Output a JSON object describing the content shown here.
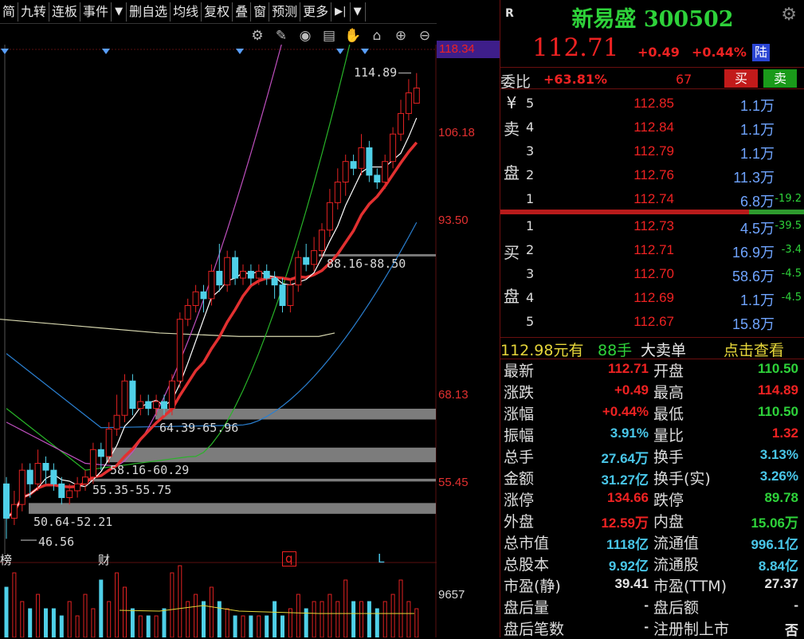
{
  "toolbar": {
    "items": [
      "简",
      "九转",
      "连板",
      "事件",
      "▼",
      "删自选",
      "均线",
      "复权",
      "叠",
      "窗",
      "预测",
      "更多",
      "▶|",
      "▼"
    ]
  },
  "chart_tools": [
    "settings-icon",
    "pen-icon",
    "eye-icon",
    "box-icon",
    "hand-icon",
    "lock-icon",
    "zoom-in-icon",
    "zoom-out-icon"
  ],
  "price_axis": {
    "top_highlight": "118.34",
    "labels": [
      "106.18",
      "93.50",
      "68.13",
      "55.45"
    ]
  },
  "annotations": {
    "high": "114.89",
    "low": "46.56",
    "zones": [
      "88.16-88.50",
      "64.39-65.96",
      "58.16-60.29",
      "55.35-55.75",
      "50.64-52.21"
    ]
  },
  "bottom_marks": [
    "榜",
    "财",
    "q",
    "L"
  ],
  "volume_axis": {
    "label": "9657"
  },
  "quote": {
    "badge": "R",
    "name": "新易盛 300502",
    "price": "112.71",
    "change": "+0.49",
    "change_pct": "+0.44%",
    "market_tag": "陆",
    "weibi_label": "委比",
    "weibi_pct": "+63.81%",
    "weibi_diff": "67",
    "buy_label": "买",
    "sell_label": "卖",
    "sell_side_label": [
      "¥",
      "卖",
      "盘"
    ],
    "buy_side_label": [
      "买",
      "盘"
    ],
    "sells": [
      {
        "level": "5",
        "price": "112.85",
        "vol": "1.1万",
        "delta": ""
      },
      {
        "level": "4",
        "price": "112.84",
        "vol": "1.1万",
        "delta": ""
      },
      {
        "level": "3",
        "price": "112.79",
        "vol": "1.1万",
        "delta": ""
      },
      {
        "level": "2",
        "price": "112.76",
        "vol": "11.3万",
        "delta": ""
      },
      {
        "level": "1",
        "price": "112.74",
        "vol": "6.8万",
        "delta": "-19.2"
      }
    ],
    "buys": [
      {
        "level": "1",
        "price": "112.73",
        "vol": "4.5万",
        "delta": "-39.5"
      },
      {
        "level": "2",
        "price": "112.71",
        "vol": "16.9万",
        "delta": "-3.4"
      },
      {
        "level": "3",
        "price": "112.70",
        "vol": "58.6万",
        "delta": "-4.5"
      },
      {
        "level": "4",
        "price": "112.69",
        "vol": "1.1万",
        "delta": "-4.5"
      },
      {
        "level": "5",
        "price": "112.67",
        "vol": "15.8万",
        "delta": ""
      }
    ],
    "tick": {
      "price": "112.98元有",
      "hands": "88手",
      "type": "大卖单",
      "link": "点击查看"
    },
    "stats": [
      {
        "k1": "最新",
        "v1": "112.71",
        "c1": "red",
        "k2": "开盘",
        "v2": "110.50",
        "c2": "green"
      },
      {
        "k1": "涨跌",
        "v1": "+0.49",
        "c1": "red",
        "k2": "最高",
        "v2": "114.89",
        "c2": "red"
      },
      {
        "k1": "涨幅",
        "v1": "+0.44%",
        "c1": "red",
        "k2": "最低",
        "v2": "110.50",
        "c2": "green"
      },
      {
        "k1": "振幅",
        "v1": "3.91%",
        "c1": "cyan",
        "k2": "量比",
        "v2": "1.32",
        "c2": "red"
      },
      {
        "k1": "总手",
        "v1": "27.64万",
        "c1": "cyan",
        "k2": "换手",
        "v2": "3.13%",
        "c2": "cyan"
      },
      {
        "k1": "金额",
        "v1": "31.27亿",
        "c1": "cyan",
        "k2": "换手(实)",
        "v2": "3.26%",
        "c2": "cyan"
      },
      {
        "k1": "涨停",
        "v1": "134.66",
        "c1": "red",
        "k2": "跌停",
        "v2": "89.78",
        "c2": "green"
      },
      {
        "k1": "外盘",
        "v1": "12.59万",
        "c1": "red",
        "k2": "内盘",
        "v2": "15.06万",
        "c2": "green"
      },
      {
        "k1": "总市值",
        "v1": "1118亿",
        "c1": "cyan",
        "k2": "流通值",
        "v2": "996.1亿",
        "c2": "cyan"
      },
      {
        "k1": "总股本",
        "v1": "9.92亿",
        "c1": "cyan",
        "k2": "流通股",
        "v2": "8.84亿",
        "c2": "cyan"
      },
      {
        "k1": "市盈(静)",
        "v1": "39.41",
        "c1": "white",
        "k2": "市盈(TTM)",
        "v2": "27.37",
        "c2": "white"
      },
      {
        "k1": "盘后量",
        "v1": "-",
        "c1": "white",
        "k2": "盘后额",
        "v2": "-",
        "c2": "white"
      },
      {
        "k1": "盘后笔数",
        "v1": "-",
        "c1": "white",
        "k2": "注册制上市",
        "v2": "否",
        "c2": "white"
      }
    ]
  },
  "colors": {
    "up": "#e22222",
    "down": "#2ed23a",
    "ma5": "#ffffff",
    "ma10": "#e23030",
    "ma20": "#c050c0",
    "ma30": "#28b428",
    "ma60": "#2a7fd0",
    "ma120": "#d8d8b0"
  },
  "candles": [
    {
      "o": 55,
      "c": 50,
      "h": 56,
      "l": 47
    },
    {
      "o": 50,
      "c": 52,
      "h": 54,
      "l": 49
    },
    {
      "o": 52,
      "c": 57,
      "h": 58,
      "l": 51
    },
    {
      "o": 57,
      "c": 55,
      "h": 58,
      "l": 53
    },
    {
      "o": 55,
      "c": 58,
      "h": 60,
      "l": 54
    },
    {
      "o": 58,
      "c": 57,
      "h": 59,
      "l": 55
    },
    {
      "o": 57,
      "c": 55,
      "h": 58,
      "l": 54
    },
    {
      "o": 55,
      "c": 53,
      "h": 56,
      "l": 52
    },
    {
      "o": 53,
      "c": 54,
      "h": 55,
      "l": 52
    },
    {
      "o": 54,
      "c": 55,
      "h": 56,
      "l": 53
    },
    {
      "o": 55,
      "c": 56,
      "h": 57,
      "l": 54
    },
    {
      "o": 56,
      "c": 60,
      "h": 61,
      "l": 55
    },
    {
      "o": 60,
      "c": 59,
      "h": 61,
      "l": 57
    },
    {
      "o": 59,
      "c": 63,
      "h": 64,
      "l": 58
    },
    {
      "o": 63,
      "c": 65,
      "h": 68,
      "l": 62
    },
    {
      "o": 65,
      "c": 70,
      "h": 71,
      "l": 64
    },
    {
      "o": 70,
      "c": 66,
      "h": 71,
      "l": 65
    },
    {
      "o": 66,
      "c": 67,
      "h": 68,
      "l": 65
    },
    {
      "o": 67,
      "c": 66,
      "h": 68,
      "l": 65
    },
    {
      "o": 66,
      "c": 67,
      "h": 68,
      "l": 65
    },
    {
      "o": 67,
      "c": 66,
      "h": 68,
      "l": 65
    },
    {
      "o": 66,
      "c": 70,
      "h": 71,
      "l": 65
    },
    {
      "o": 70,
      "c": 79,
      "h": 80,
      "l": 69
    },
    {
      "o": 79,
      "c": 81,
      "h": 82,
      "l": 78
    },
    {
      "o": 81,
      "c": 83,
      "h": 84,
      "l": 80
    },
    {
      "o": 83,
      "c": 82,
      "h": 84,
      "l": 80
    },
    {
      "o": 82,
      "c": 86,
      "h": 87,
      "l": 81
    },
    {
      "o": 86,
      "c": 84,
      "h": 90,
      "l": 83
    },
    {
      "o": 84,
      "c": 88,
      "h": 89,
      "l": 83
    },
    {
      "o": 88,
      "c": 85,
      "h": 89,
      "l": 84
    },
    {
      "o": 85,
      "c": 86,
      "h": 87,
      "l": 84
    },
    {
      "o": 86,
      "c": 85,
      "h": 87,
      "l": 84
    },
    {
      "o": 85,
      "c": 86,
      "h": 87,
      "l": 84
    },
    {
      "o": 86,
      "c": 85,
      "h": 87,
      "l": 84
    },
    {
      "o": 85,
      "c": 84,
      "h": 86,
      "l": 82
    },
    {
      "o": 84,
      "c": 81,
      "h": 85,
      "l": 80
    },
    {
      "o": 81,
      "c": 84,
      "h": 85,
      "l": 80
    },
    {
      "o": 84,
      "c": 88,
      "h": 89,
      "l": 83
    },
    {
      "o": 88,
      "c": 87,
      "h": 90,
      "l": 86
    },
    {
      "o": 87,
      "c": 89,
      "h": 91,
      "l": 86
    },
    {
      "o": 89,
      "c": 92,
      "h": 93,
      "l": 88
    },
    {
      "o": 92,
      "c": 96,
      "h": 98,
      "l": 91
    },
    {
      "o": 96,
      "c": 99,
      "h": 101,
      "l": 95
    },
    {
      "o": 99,
      "c": 102,
      "h": 103,
      "l": 97
    },
    {
      "o": 102,
      "c": 101,
      "h": 103,
      "l": 100
    },
    {
      "o": 101,
      "c": 104,
      "h": 106,
      "l": 100
    },
    {
      "o": 104,
      "c": 100,
      "h": 105,
      "l": 99
    },
    {
      "o": 100,
      "c": 99,
      "h": 101,
      "l": 98
    },
    {
      "o": 99,
      "c": 102,
      "h": 103,
      "l": 98
    },
    {
      "o": 102,
      "c": 106,
      "h": 107,
      "l": 101
    },
    {
      "o": 106,
      "c": 109,
      "h": 111,
      "l": 105
    },
    {
      "o": 109,
      "c": 112,
      "h": 114,
      "l": 108
    },
    {
      "o": 110.5,
      "c": 112.71,
      "h": 114.89,
      "l": 110.5
    }
  ],
  "volumes": [
    7,
    9,
    5,
    4,
    6,
    4,
    4,
    3,
    5,
    3,
    6,
    4,
    8,
    5,
    9,
    7,
    4,
    3,
    3,
    3,
    4,
    9,
    10,
    5,
    6,
    5,
    7,
    5,
    4,
    3,
    3,
    3,
    3,
    3,
    5,
    3,
    4,
    6,
    4,
    5,
    5,
    6,
    5,
    8,
    5,
    5,
    5,
    4,
    5,
    6,
    8,
    5,
    4
  ]
}
